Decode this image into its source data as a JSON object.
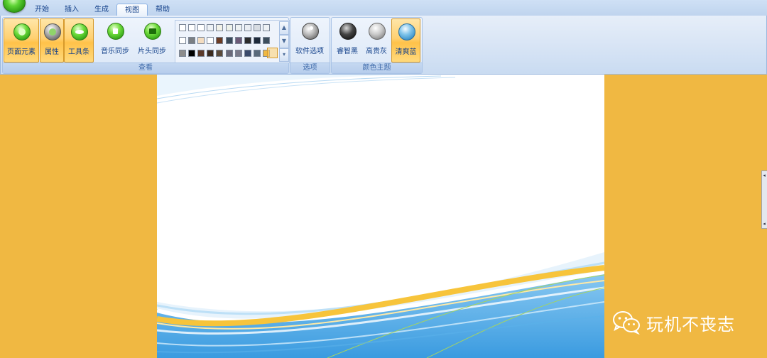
{
  "tabs": [
    "开始",
    "插入",
    "生成",
    "视图",
    "帮助"
  ],
  "active_tab": "视图",
  "ribbon": {
    "view_group": {
      "label": "查看",
      "buttons": {
        "page_elements": "页面元素",
        "properties": "属性",
        "toolbar": "工具条",
        "music_sync": "音乐同步",
        "header_sync": "片头同步"
      }
    },
    "options_group": {
      "label": "选项",
      "software_options": "软件选项"
    },
    "theme_group": {
      "label": "颜色主题",
      "dark_black": "睿智黑",
      "elegant_gray": "高贵灰",
      "fresh_blue": "清爽蓝"
    }
  },
  "swatches": {
    "row1": [
      "#ffffff",
      "#ffffff",
      "#ffffff",
      "#eef2f5",
      "#f2f2e8",
      "#eef2ea",
      "#eef2f2",
      "#e9edf2",
      "#d7dce2",
      "#eef2f5"
    ],
    "row2": [
      "#ffffff",
      "#7b7f83",
      "#f3dcc0",
      "#ffffff",
      "#6b3b24",
      "#3a4a5a",
      "#6c5a77",
      "#2c2c2c",
      "#1e2a3a",
      "#3c4d5c"
    ],
    "row3": [
      "#8c8c8c",
      "#000000",
      "#5b3a2a",
      "#3b2a1e",
      "#5a4a3a",
      "#6a6a7a",
      "#7a7a8a",
      "#3a4a6a",
      "#5a6a7a",
      "#f0b842"
    ]
  },
  "watermark": {
    "icon": "wechat-icon",
    "text": "玩机不丧志"
  },
  "colors": {
    "workspace_bg": "#f0b842",
    "ribbon_accent": "#ffd071",
    "text": "#15428b"
  }
}
